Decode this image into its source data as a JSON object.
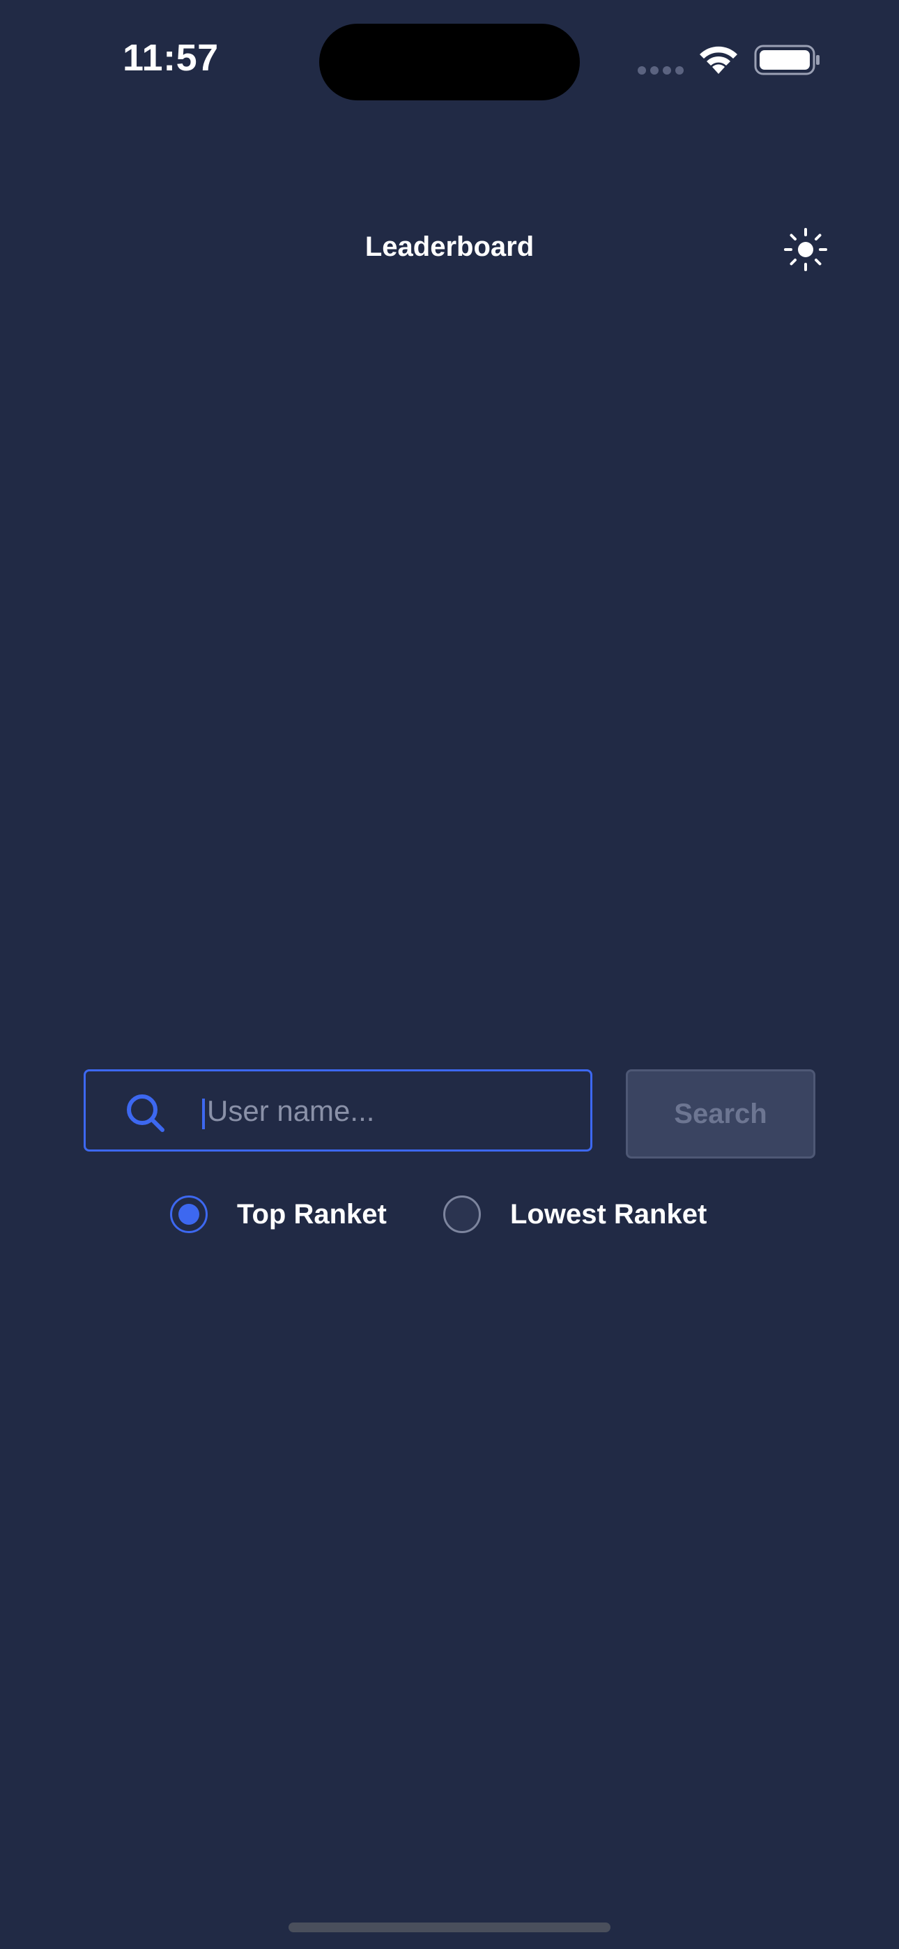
{
  "status_bar": {
    "time": "11:57",
    "signal_icon": "cellular-signal-icon",
    "wifi_icon": "wifi-icon",
    "battery_icon": "battery-icon"
  },
  "header": {
    "title": "Leaderboard",
    "theme_toggle_icon": "sun-icon"
  },
  "search": {
    "icon": "search-icon",
    "placeholder": "User name...",
    "value": "",
    "button_label": "Search",
    "button_enabled": false
  },
  "sort_options": [
    {
      "label": "Top Ranket",
      "selected": true
    },
    {
      "label": "Lowest Ranket",
      "selected": false
    }
  ],
  "colors": {
    "background": "#212a45",
    "accent": "#3d68f0",
    "disabled_button": "#3a4461",
    "disabled_text": "#6d7692",
    "text": "#ffffff"
  }
}
